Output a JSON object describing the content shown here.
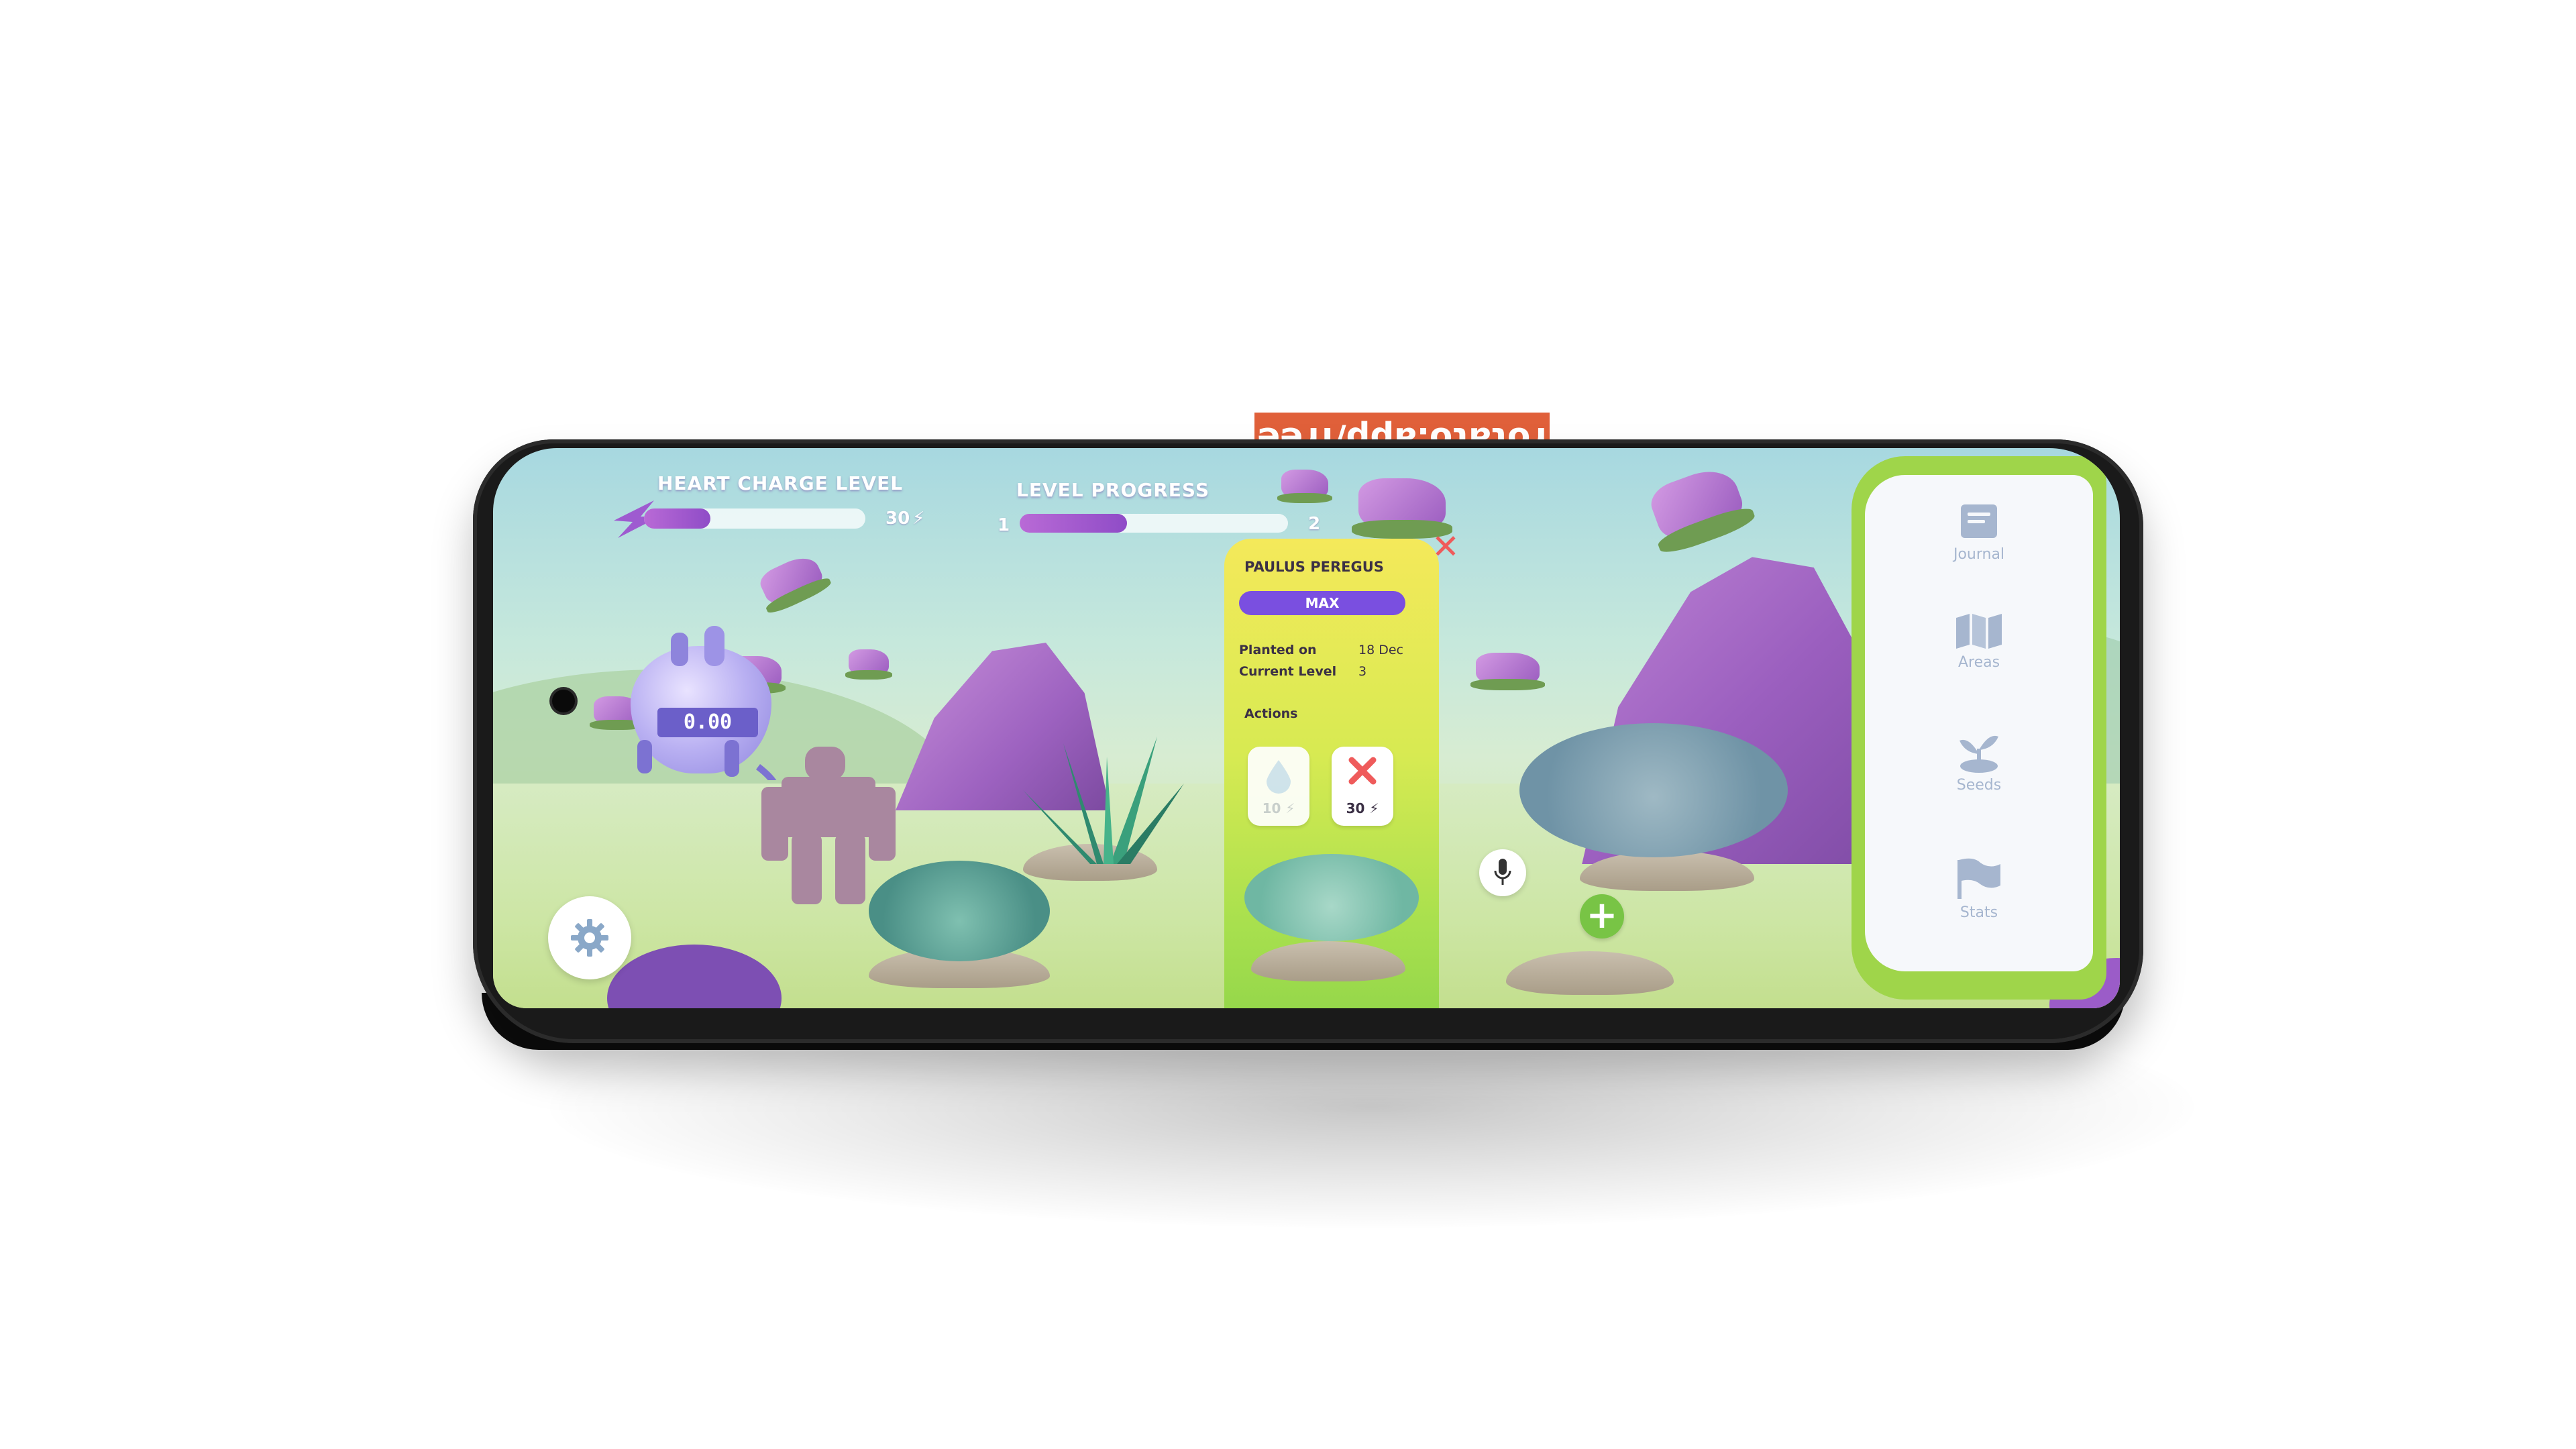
{
  "watermark": "rotato.app/free",
  "hud": {
    "heart_label": "HEART CHARGE LEVEL",
    "heart_value": "30",
    "heart_fill_fraction": 0.3,
    "level_label": "LEVEL PROGRESS",
    "level_start": "1",
    "level_end": "2",
    "level_fill_fraction": 0.4
  },
  "heart": {
    "value": "0.00"
  },
  "plant_panel": {
    "name": "PAULUS PEREGUS",
    "badge": "MAX",
    "planted_on_label": "Planted on",
    "planted_on_value": "18 Dec",
    "current_level_label": "Current Level",
    "current_level_value": "3",
    "actions_label": "Actions",
    "actions": [
      {
        "icon": "water-drop-icon",
        "cost": "10",
        "enabled": false
      },
      {
        "icon": "remove-x-icon",
        "cost": "30",
        "enabled": true
      }
    ]
  },
  "nav": {
    "items": [
      {
        "label": "Journal",
        "icon": "book-icon"
      },
      {
        "label": "Areas",
        "icon": "map-icon"
      },
      {
        "label": "Seeds",
        "icon": "seedling-icon"
      },
      {
        "label": "Stats",
        "icon": "flag-icon"
      }
    ]
  },
  "colors": {
    "accent_purple": "#7a4fe0",
    "panel_yellow": "#f4e95a",
    "panel_green": "#93d64a",
    "close_red": "#ef5b5b",
    "nav_icon": "#a6b6cf"
  }
}
